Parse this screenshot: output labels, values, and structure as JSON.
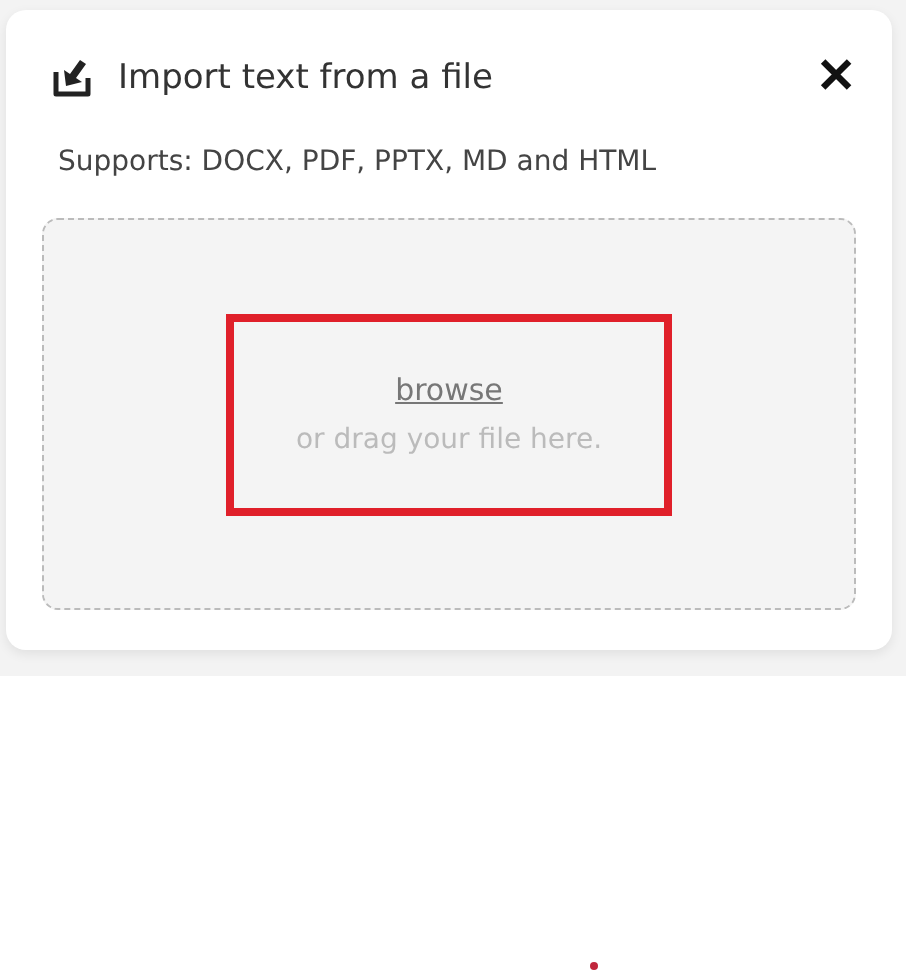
{
  "dialog": {
    "title": "Import text from a file",
    "close": "✕",
    "supports": "Supports: DOCX, PDF, PPTX, MD and HTML"
  },
  "dropzone": {
    "link": "browse",
    "hint": "or drag your file here.",
    "highlighted": true
  }
}
